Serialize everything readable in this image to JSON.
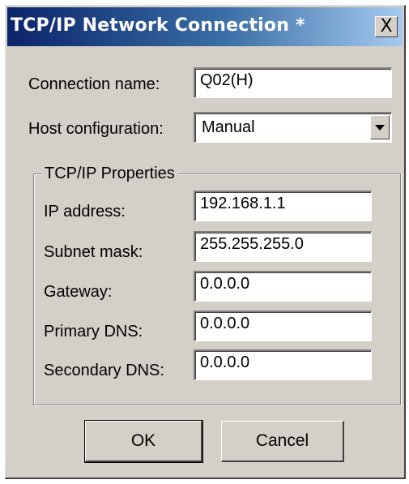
{
  "window": {
    "title": "TCP/IP Network Connection *",
    "close_glyph": "X"
  },
  "form": {
    "connection_name_label": "Connection name:",
    "connection_name_value": "Q02(H)",
    "host_config_label": "Host configuration:",
    "host_config_value": "Manual",
    "host_config_arrow_icon": "chevron-down-icon"
  },
  "tcpip_group": {
    "title": "TCP/IP Properties",
    "fields": [
      {
        "label": "IP address:",
        "value": "192.168.1.1"
      },
      {
        "label": "Subnet mask:",
        "value": "255.255.255.0"
      },
      {
        "label": "Gateway:",
        "value": "0.0.0.0"
      },
      {
        "label": "Primary DNS:",
        "value": "0.0.0.0"
      },
      {
        "label": "Secondary DNS:",
        "value": "0.0.0.0"
      }
    ]
  },
  "buttons": {
    "ok_label": "OK",
    "cancel_label": "Cancel"
  },
  "colors": {
    "titlebar_start": "#0a246a",
    "titlebar_end": "#a6caf0",
    "dialog_face": "#d4d0c8"
  }
}
